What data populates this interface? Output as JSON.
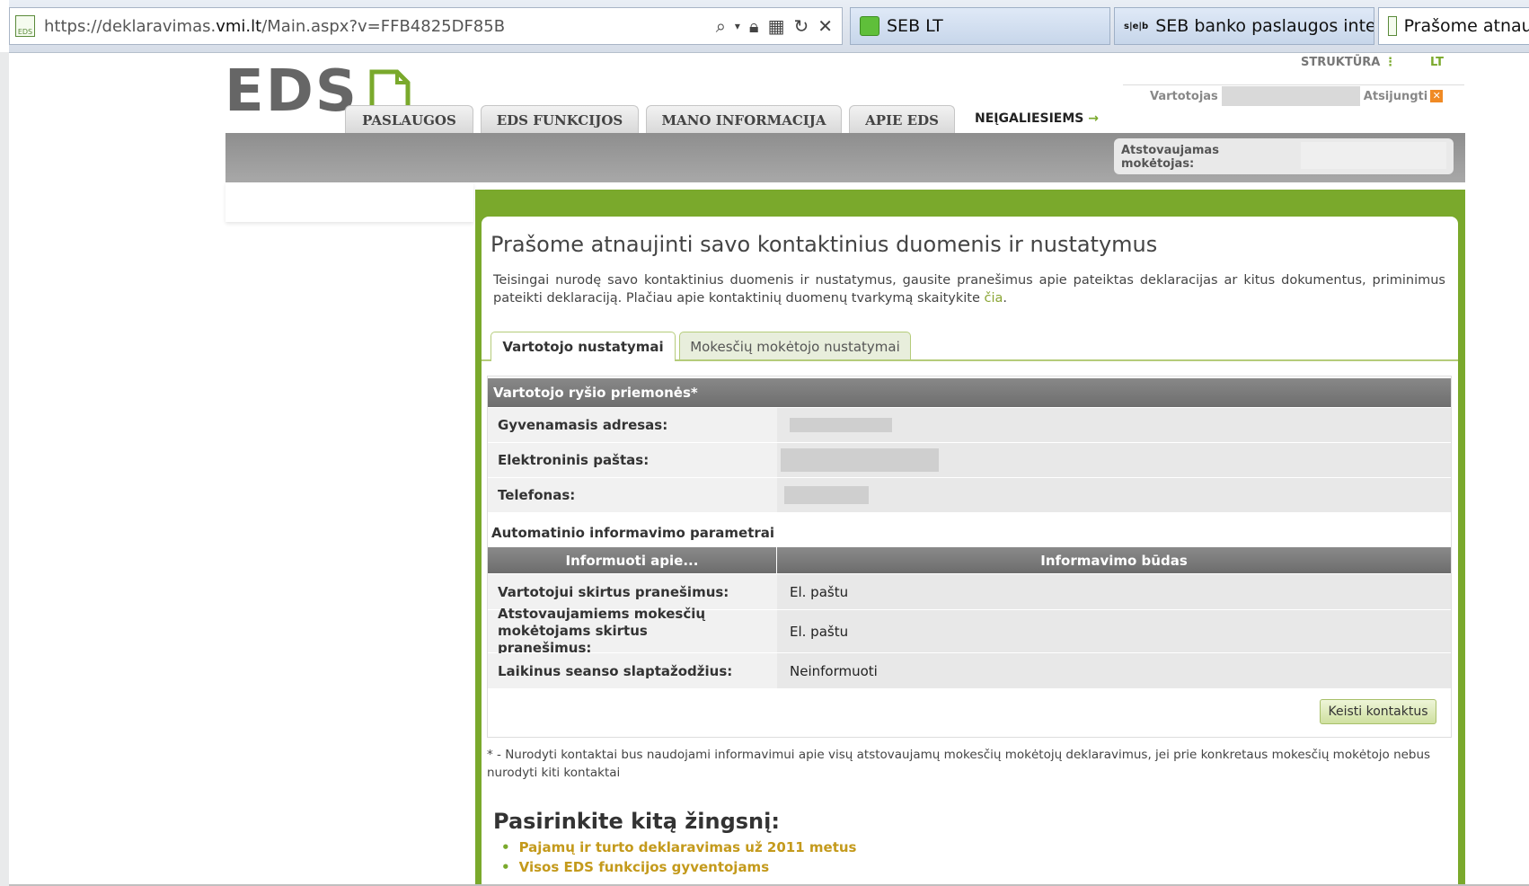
{
  "browser": {
    "url_prefix": "https://deklaravimas.",
    "url_domain": "vmi.lt",
    "url_rest": "/Main.aspx?v=FFB4825DF85B",
    "tabs": [
      {
        "label": "SEB LT"
      },
      {
        "label": "SEB banko paslaugos inter..."
      },
      {
        "label": "Prašome atnauj"
      }
    ],
    "seb_icon_text": "s|e|b",
    "eds_fav_text": "EDS"
  },
  "header": {
    "logo": "EDS",
    "structure_link": "STRUKTŪRA",
    "lang": "LT",
    "user_label": "Vartotojas",
    "logout": "Atsijungti",
    "nav": [
      "PASLAUGOS",
      "EDS FUNKCIJOS",
      "MANO INFORMACIJA",
      "APIE EDS"
    ],
    "accessibility_link": "NEĮGALIESIEMS",
    "represented_payer_label": "Atstovaujamas mokėtojas:"
  },
  "main": {
    "title": "Prašome atnaujinti savo kontaktinius duomenis ir nustatymus",
    "intro": "Teisingai nurodę savo kontaktinius duomenis ir nustatymus, gausite pranešimus apie pateiktas deklaracijas ar kitus dokumentus, priminimus pateikti deklaraciją. Plačiau apie kontaktinių duomenų tvarkymą skaitykite ",
    "intro_link": "čia",
    "intro_end": ".",
    "tabs": [
      "Vartotojo nustatymai",
      "Mokesčių mokėtojo nustatymai"
    ],
    "section_title": "Vartotojo ryšio priemonės*",
    "contact_rows": [
      {
        "label": "Gyvenamasis adresas:"
      },
      {
        "label": "Elektroninis paštas:"
      },
      {
        "label": "Telefonas:"
      }
    ],
    "auto_title": "Automatinio informavimo parametrai",
    "col_about": "Informuoti apie...",
    "col_method": "Informavimo būdas",
    "notify_rows": [
      {
        "label": "Vartotojui skirtus pranešimus:",
        "value": "El. paštu"
      },
      {
        "label": "Atstovaujamiems mokesčių mokėtojams skirtus pranešimus:",
        "value": "El. paštu"
      },
      {
        "label": "Laikinus seanso slaptažodžius:",
        "value": "Neinformuoti"
      }
    ],
    "change_button": "Keisti kontaktus",
    "footnote": "* - Nurodyti kontaktai bus naudojami informavimui apie visų atstovaujamų mokesčių mokėtojų deklaravimus, jei prie konkretaus mokesčių mokėtojo nebus nurodyti kiti kontaktai",
    "next_title": "Pasirinkite kitą žingsnį:",
    "next_links": [
      "Pajamų ir turto deklaravimas už 2011 metus",
      "Visos EDS funkcijos gyventojams"
    ]
  },
  "colors": {
    "accent_green": "#7aa92c",
    "link_gold": "#c49a1c",
    "header_grey": "#7a7a7a"
  }
}
